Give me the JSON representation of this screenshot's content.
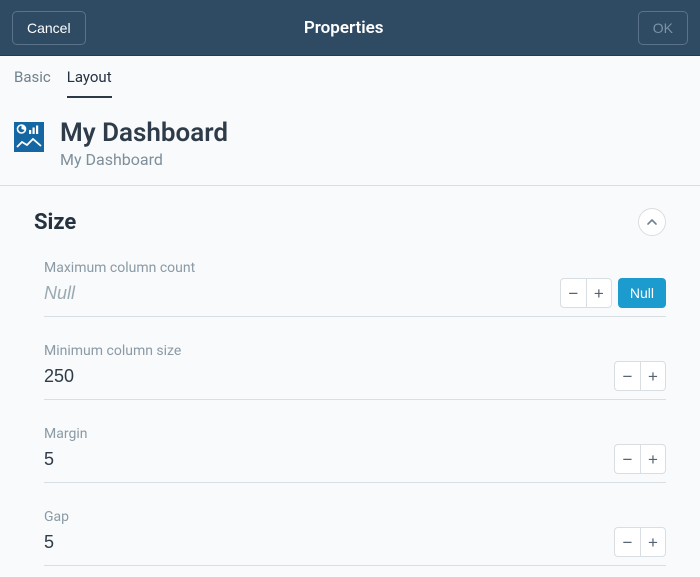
{
  "header": {
    "cancel_label": "Cancel",
    "title": "Properties",
    "ok_label": "OK"
  },
  "tabs": {
    "basic": "Basic",
    "layout": "Layout",
    "active": "layout"
  },
  "dashboard": {
    "title": "My Dashboard",
    "subtitle": "My Dashboard"
  },
  "section": {
    "title": "Size"
  },
  "props": {
    "max_col_count": {
      "label": "Maximum column count",
      "value": "Null",
      "is_null": true,
      "null_btn": "Null"
    },
    "min_col_size": {
      "label": "Minimum column size",
      "value": "250"
    },
    "margin": {
      "label": "Margin",
      "value": "5"
    },
    "gap": {
      "label": "Gap",
      "value": "5"
    }
  },
  "icons": {
    "minus": "−",
    "plus": "+"
  }
}
